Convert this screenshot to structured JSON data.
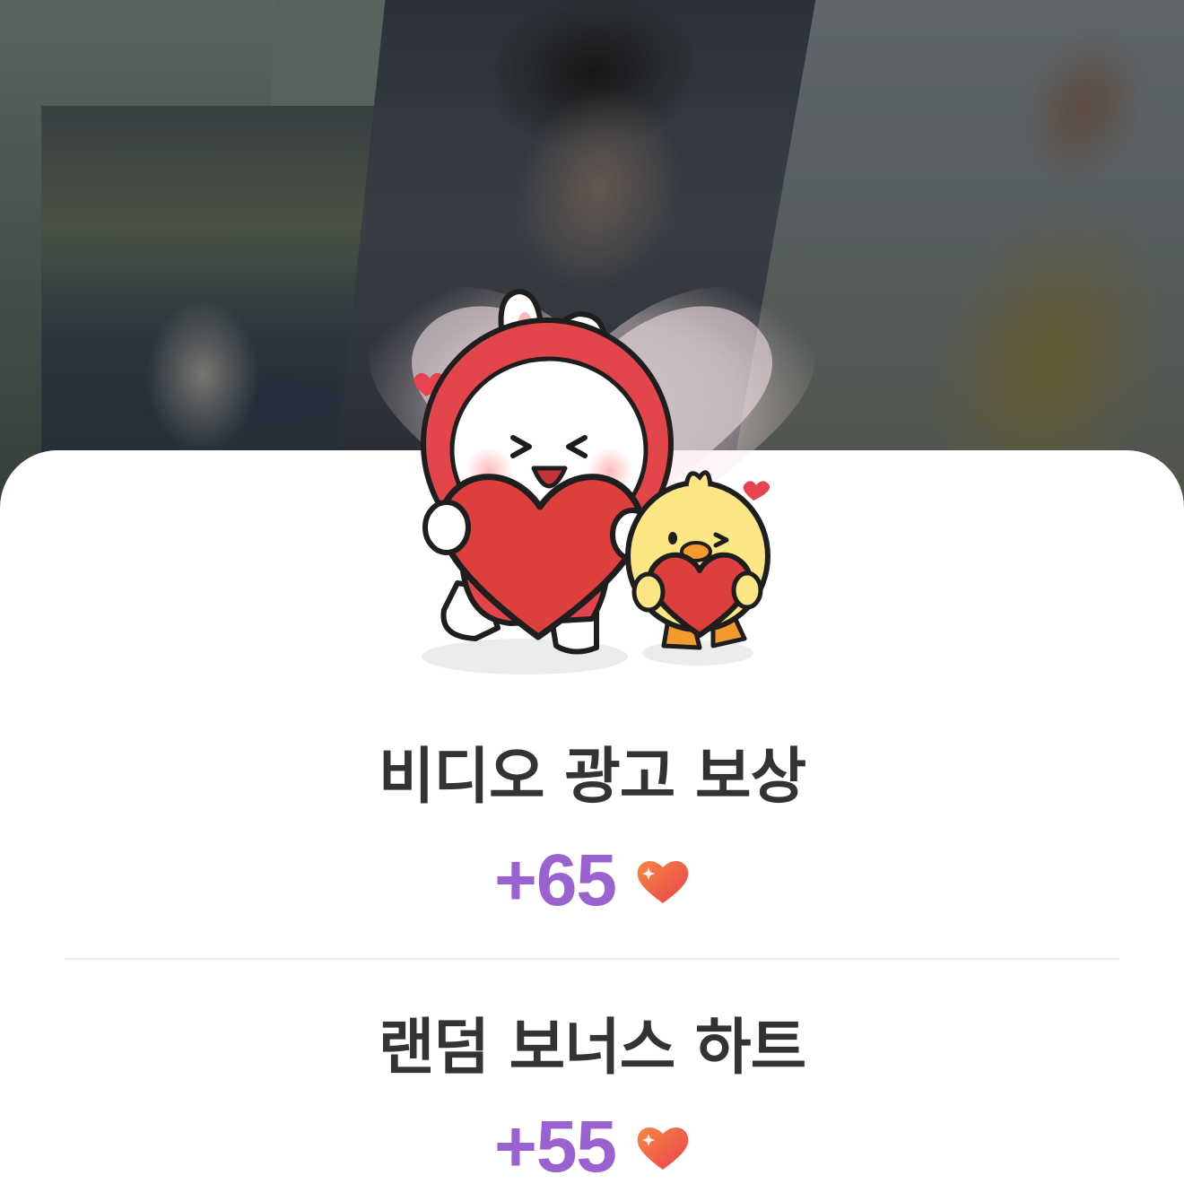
{
  "rewards": [
    {
      "title": "비디오 광고 보상",
      "amount": "+65",
      "icon": "heart-icon"
    },
    {
      "title": "랜덤 보너스 하트",
      "amount": "+55",
      "icon": "heart-icon"
    }
  ],
  "colors": {
    "amount": "#9a62d1",
    "title": "#333333",
    "heart_top": "#f47a4a",
    "heart_bottom": "#e8434f",
    "sheet": "#ffffff"
  }
}
